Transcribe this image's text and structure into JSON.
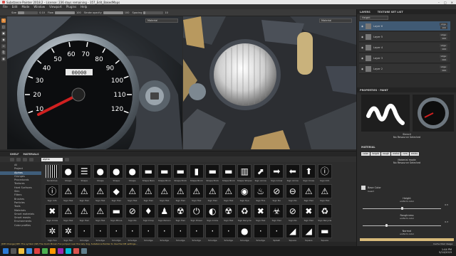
{
  "window": {
    "title": "Substance Painter 2018.2 - License: 236 days remaining - 357_Edit_BakedMaps"
  },
  "menu": [
    "File",
    "Edit",
    "Mode",
    "Window",
    "Viewport",
    "Plugins",
    "Help"
  ],
  "toolbar": {
    "size_label": "Size",
    "size_value": "0.10",
    "flow_label": "Flow",
    "flow_value": "100",
    "stroke_opacity_label": "Stroke opacity",
    "stroke_opacity_value": "100",
    "spacing_label": "Spacing",
    "spacing_value": "10",
    "size_fill": 0.3,
    "flow_fill": 1.0,
    "stroke_fill": 1.0,
    "spacing_fill": 0.1
  },
  "viewport": {
    "label_3d": "Material",
    "label_2d": "Material"
  },
  "speedometer": {
    "ticks": [
      "10",
      "20",
      "30",
      "40",
      "50",
      "60",
      "70",
      "80",
      "90",
      "100",
      "110",
      "120"
    ],
    "odometer": "00000"
  },
  "shelf": {
    "tabs": [
      "SHELF",
      "MATERIALS"
    ],
    "search": "alpha",
    "categories": [
      "All",
      "Project",
      "Alphas",
      "Grunges",
      "Procedurals",
      "Textures",
      "Hard Surfaces",
      "Skin",
      "Filters",
      "Brushes",
      "Particles",
      "Tools",
      "Materials",
      "Smart materials",
      "Smart masks",
      "Environments",
      "Color profiles"
    ],
    "selected_category": "Alphas",
    "items": [
      {
        "name": "Scratches",
        "glyph": ""
      },
      {
        "name": "Shape",
        "glyph": "●"
      },
      {
        "name": "Shape",
        "glyph": "☰"
      },
      {
        "name": "Shape",
        "glyph": "●"
      },
      {
        "name": "Shape",
        "glyph": "●"
      },
      {
        "name": "Shape",
        "glyph": "●"
      },
      {
        "name": "Shape Bars",
        "glyph": "▬"
      },
      {
        "name": "Shape Brick",
        "glyph": "▬"
      },
      {
        "name": "Shape Brick",
        "glyph": "▬"
      },
      {
        "name": "Shape Brick",
        "glyph": "▮"
      },
      {
        "name": "Shape Brick",
        "glyph": "▬"
      },
      {
        "name": "Shape Brick",
        "glyph": "▬"
      },
      {
        "name": "Shape Stripes",
        "glyph": "▥"
      },
      {
        "name": "Sign Arrow",
        "glyph": "⬈"
      },
      {
        "name": "Sign Arrow",
        "glyph": "➡"
      },
      {
        "name": "Sign Arrow",
        "glyph": "⬅"
      },
      {
        "name": "Sign Cross",
        "glyph": "⬆"
      },
      {
        "name": "Sign Info",
        "glyph": "ⓘ"
      },
      {
        "name": "Sign Info",
        "glyph": "ⓘ"
      },
      {
        "name": "Sign Haz",
        "glyph": "⚠"
      },
      {
        "name": "Sign Haz",
        "glyph": "⚠"
      },
      {
        "name": "Sign Haz",
        "glyph": "⚠"
      },
      {
        "name": "Sign Haz",
        "glyph": "◆"
      },
      {
        "name": "Sign Haz",
        "glyph": "⚠"
      },
      {
        "name": "Sign Haz",
        "glyph": "⚠"
      },
      {
        "name": "Sign Haz",
        "glyph": "⚠"
      },
      {
        "name": "Sign Haz",
        "glyph": "⚠"
      },
      {
        "name": "Sign Haz",
        "glyph": "⚠"
      },
      {
        "name": "Sign Haz",
        "glyph": "⚠"
      },
      {
        "name": "Sign Haz",
        "glyph": "⚠"
      },
      {
        "name": "Sign Eye",
        "glyph": "◉"
      },
      {
        "name": "Sign Fire",
        "glyph": "♨"
      },
      {
        "name": "Sign No",
        "glyph": "⊘"
      },
      {
        "name": "Sign No",
        "glyph": "⊖"
      },
      {
        "name": "Sign Haz",
        "glyph": "⚠"
      },
      {
        "name": "Sign Haz",
        "glyph": "⚠"
      },
      {
        "name": "Sign Cross",
        "glyph": "✖"
      },
      {
        "name": "Sign Haz",
        "glyph": "⚠"
      },
      {
        "name": "Sign Haz",
        "glyph": "⚠"
      },
      {
        "name": "Sign Haz",
        "glyph": "⚠"
      },
      {
        "name": "Sign Minus",
        "glyph": "▬"
      },
      {
        "name": "Sign No",
        "glyph": "⊘"
      },
      {
        "name": "Sign Drop",
        "glyph": "♦"
      },
      {
        "name": "Sign Person",
        "glyph": "♟"
      },
      {
        "name": "Sign Haz",
        "glyph": "☢"
      },
      {
        "name": "Sign Power",
        "glyph": "⏻"
      },
      {
        "name": "Sign Circle",
        "glyph": "◐"
      },
      {
        "name": "Sign Haz",
        "glyph": "☢"
      },
      {
        "name": "Sign Recycle",
        "glyph": "♻"
      },
      {
        "name": "Sign Haz",
        "glyph": "✖"
      },
      {
        "name": "Sign Haz",
        "glyph": "☣"
      },
      {
        "name": "Sign No",
        "glyph": "⊘"
      },
      {
        "name": "Sign Haz",
        "glyph": "✖"
      },
      {
        "name": "Sign Recycle",
        "glyph": "♻"
      },
      {
        "name": "Sign Fan",
        "glyph": "✲"
      },
      {
        "name": "Sign Fan",
        "glyph": "✲"
      },
      {
        "name": "Smudge",
        "glyph": "·"
      },
      {
        "name": "Smudge",
        "glyph": "·"
      },
      {
        "name": "Smudge",
        "glyph": "·"
      },
      {
        "name": "Smudge",
        "glyph": "·"
      },
      {
        "name": "Smudge",
        "glyph": "·"
      },
      {
        "name": "Smudge",
        "glyph": "·"
      },
      {
        "name": "Smudge",
        "glyph": "·"
      },
      {
        "name": "Smudge",
        "glyph": "·"
      },
      {
        "name": "Smudge",
        "glyph": "·"
      },
      {
        "name": "Smudge",
        "glyph": "·"
      },
      {
        "name": "Smudge",
        "glyph": "●"
      },
      {
        "name": "Smudge",
        "glyph": "·"
      },
      {
        "name": "Splash",
        "glyph": "·"
      },
      {
        "name": "Square",
        "glyph": "◢"
      },
      {
        "name": "Square",
        "glyph": "◢"
      },
      {
        "name": "Square",
        "glyph": "▬"
      }
    ]
  },
  "layers": {
    "tabs": [
      "LAYERS",
      "TEXTURE SET LIST"
    ],
    "channel": "Height",
    "items": [
      {
        "name": "Layer 6",
        "mode": "Ldge",
        "opacity": "100"
      },
      {
        "name": "Layer 5",
        "mode": "Ldge",
        "opacity": "100"
      },
      {
        "name": "Layer 4",
        "mode": "Ldge",
        "opacity": "100"
      },
      {
        "name": "Layer 3",
        "mode": "Ldge",
        "opacity": "100"
      },
      {
        "name": "Layer 2",
        "mode": "Ldge",
        "opacity": "100"
      }
    ],
    "selected": 0
  },
  "properties": {
    "title": "PROPERTIES - PAINT",
    "stencil_label": "Stencil",
    "stencil_value": "No Resource Selected",
    "material_header": "MATERIAL",
    "channels": [
      "color",
      "height",
      "rough",
      "metal",
      "nrm",
      "emiss"
    ],
    "material_mode_label": "Material mode",
    "material_mode_value": "No Resource Selected",
    "base_color_label": "Base Color",
    "base_color_sub": "Invert",
    "height_label": "Height",
    "height_sub": "uniform color",
    "height_value": "0.5",
    "roughness_label": "Roughness",
    "roughness_sub": "uniform color",
    "roughness_value": "0.3",
    "normal_label": "Normal",
    "normal_sub": "uniform color",
    "footer": "Cache Disk Usage: ",
    "height_level": 0.5,
    "roughness_level": 0.3
  },
  "log": "[DPI Change] DPI: The symbol (SP) The Quick Brown Fox jumped over the lazy dog, Substance Painter to Use the DPI settings...",
  "tray": {
    "time": "1:44 PM",
    "date": "5/14/2019"
  },
  "colors": {
    "accent": "#e08a3a",
    "selection": "#405a74",
    "needle": "#d02020"
  }
}
